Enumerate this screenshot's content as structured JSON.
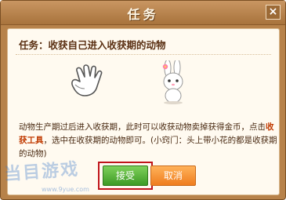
{
  "dialog": {
    "title": "任务",
    "close_glyph": "×",
    "task_title": "任务：收获自己进入收获期的动物",
    "hand_icon": "hand-icon",
    "rabbit_icon": "rabbit-icon",
    "description": {
      "part1": "动物生产期过后进入收获期，此时可以收获动物卖掉获得金币，点击",
      "highlight": "收获工具",
      "part2": "，选中在收获期的动物即可。(小窍门：头上带小花的都是收获期的动物)"
    },
    "buttons": {
      "accept": "接受",
      "cancel": "取消"
    }
  },
  "watermark": {
    "text": "当目游戏",
    "url": "www.9yue.com"
  }
}
